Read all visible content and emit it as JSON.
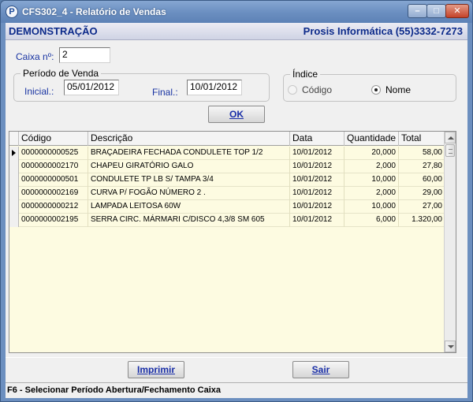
{
  "window": {
    "title": "CFS302_4 - Relatório de Vendas",
    "app_icon": "P",
    "min_glyph": "–",
    "max_glyph": "□",
    "close_glyph": "✕"
  },
  "banner": {
    "left": "DEMONSTRAÇÃO",
    "right": "Prosis Informática (55)3332-7273"
  },
  "caixa": {
    "label": "Caixa nº:",
    "value": "2"
  },
  "periodo": {
    "title": "Período de Venda",
    "inicial_label": "Inicial.:",
    "inicial_value": "05/01/2012",
    "final_label": "Final.:",
    "final_value": "10/01/2012"
  },
  "indice": {
    "title": "Índice",
    "options": [
      {
        "label": "Código",
        "selected": false,
        "enabled": false
      },
      {
        "label": "Nome",
        "selected": true,
        "enabled": true
      }
    ]
  },
  "buttons": {
    "ok": "OK",
    "imprimir": "Imprimir",
    "sair": "Sair"
  },
  "grid": {
    "columns": [
      "Código",
      "Descrição",
      "Data",
      "Quantidade",
      "Total"
    ],
    "rows": [
      [
        "0000000000525",
        "BRAÇADEIRA FECHADA CONDULETE TOP 1/2",
        "10/01/2012",
        "20,000",
        "58,00"
      ],
      [
        "0000000002170",
        "CHAPEU GIRATÓRIO GALO",
        "10/01/2012",
        "2,000",
        "27,80"
      ],
      [
        "0000000000501",
        "CONDULETE TP LB S/ TAMPA 3/4",
        "10/01/2012",
        "10,000",
        "60,00"
      ],
      [
        "0000000002169",
        "CURVA P/ FOGÃO NÚMERO 2 .",
        "10/01/2012",
        "2,000",
        "29,00"
      ],
      [
        "0000000000212",
        "LAMPADA LEITOSA 60W",
        "10/01/2012",
        "10,000",
        "27,00"
      ],
      [
        "0000000002195",
        "SERRA CIRC. MÁRMARI  C/DISCO 4,3/8 SM 605",
        "10/01/2012",
        "6,000",
        "1.320,00"
      ]
    ]
  },
  "status": "F6 - Selecionar Período Abertura/Fechamento Caixa"
}
